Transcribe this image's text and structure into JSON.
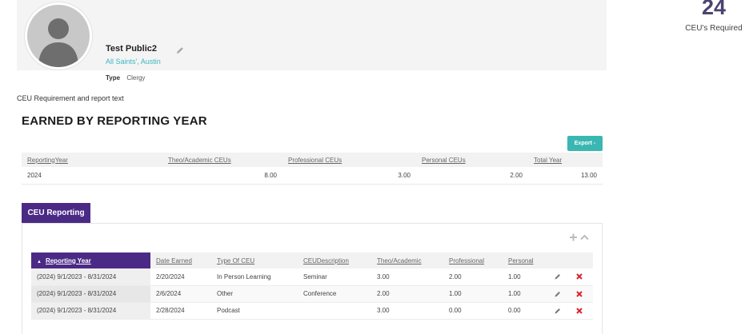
{
  "profile": {
    "name": "Test Public2",
    "location": "All Saints', Austin",
    "type_label": "Type",
    "type_value": "Clergy"
  },
  "ceu_summary": {
    "count": "24",
    "label": "CEU's Required"
  },
  "requirement_text": "CEU Requirement and report  text",
  "earned": {
    "title": "EARNED BY REPORTING YEAR",
    "export_label": "Export -",
    "columns": [
      "ReportingYear",
      "Theo/Academic CEUs",
      "Professional CEUs",
      "Personal CEUs",
      "Total Year"
    ],
    "rows": [
      [
        "2024",
        "8.00",
        "3.00",
        "2.00",
        "13.00"
      ]
    ]
  },
  "tab": {
    "label": "CEU Reporting"
  },
  "ceu_table": {
    "sort_indicator": "▲",
    "columns": [
      "Reporting Year",
      "Date Earned",
      "Type Of CEU",
      "CEUDescription",
      "Theo/Academic",
      "Professional",
      "Personal"
    ],
    "rows": [
      [
        "(2024) 9/1/2023 - 8/31/2024",
        "2/20/2024",
        "In Person Learning",
        "Seminar",
        "3.00",
        "2.00",
        "1.00"
      ],
      [
        "(2024) 9/1/2023 - 8/31/2024",
        "2/6/2024",
        "Other",
        "Conference",
        "2.00",
        "1.00",
        "1.00"
      ],
      [
        "(2024) 9/1/2023 - 8/31/2024",
        "2/28/2024",
        "Podcast",
        "",
        "3.00",
        "0.00",
        "0.00"
      ]
    ]
  },
  "colors": {
    "accent_purple": "#4b2a86",
    "accent_teal": "#3ab7b2",
    "delete_red": "#d9232d"
  },
  "icons": [
    "pencil-icon",
    "plus-icon",
    "chevron-up-icon",
    "delete-x-icon",
    "sort-up-icon"
  ]
}
